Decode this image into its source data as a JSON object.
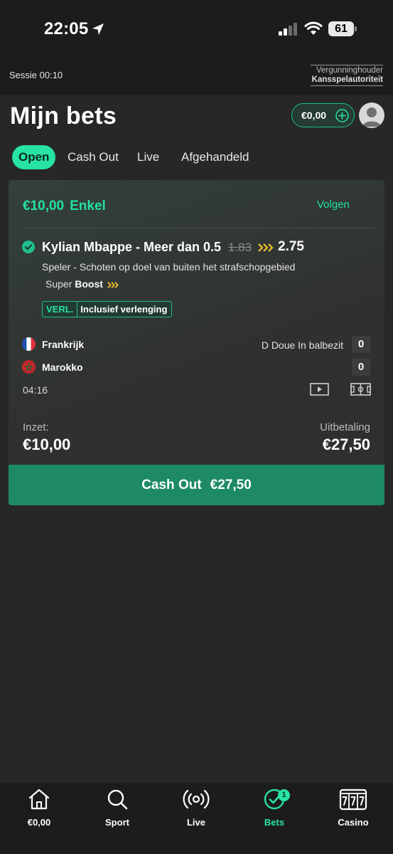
{
  "status_bar": {
    "time": "22:05",
    "battery": "61"
  },
  "session": {
    "text": "Sessie 00:10",
    "license_top": "Vergunninghouder",
    "license_bottom": "Kansspelautoriteit"
  },
  "header": {
    "title": "Mijn bets",
    "balance": "€0,00",
    "tabs": [
      {
        "label": "Open"
      },
      {
        "label": "Cash Out"
      },
      {
        "label": "Live"
      },
      {
        "label": "Afgehandeld"
      }
    ]
  },
  "bet": {
    "stake_amount": "€10,00",
    "bet_type": "Enkel",
    "follow_label": "Volgen",
    "selection": "Kylian Mbappe - Meer dan 0.5",
    "old_odds": "1.83",
    "new_odds": "2.75",
    "market": "Speler - Schoten op doel van buiten het strafschopgebied",
    "boost_prefix": "Super",
    "boost_word": "Boost",
    "badge_code": "VERL.",
    "badge_label": "Inclusief verlenging",
    "home_team": "Frankrijk",
    "away_team": "Marokko",
    "possession": "D Doue In balbezit",
    "home_score": "0",
    "away_score": "0",
    "clock": "04:16",
    "stake_label": "Inzet:",
    "stake_value": "€10,00",
    "payout_label": "Uitbetaling",
    "payout_value": "€27,50",
    "cashout_label": "Cash Out",
    "cashout_value": "€27,50"
  },
  "bottom_nav": {
    "items": [
      {
        "label": "€0,00",
        "icon": "home-icon"
      },
      {
        "label": "Sport",
        "icon": "search-icon"
      },
      {
        "label": "Live",
        "icon": "live-broadcast-icon"
      },
      {
        "label": "Bets",
        "icon": "bets-check-icon",
        "badge": "1"
      },
      {
        "label": "Casino",
        "icon": "slot-machine-icon"
      }
    ]
  },
  "colors": {
    "accent": "#28e3a6",
    "cashout": "#1d8a63",
    "boost": "#f2c230"
  }
}
